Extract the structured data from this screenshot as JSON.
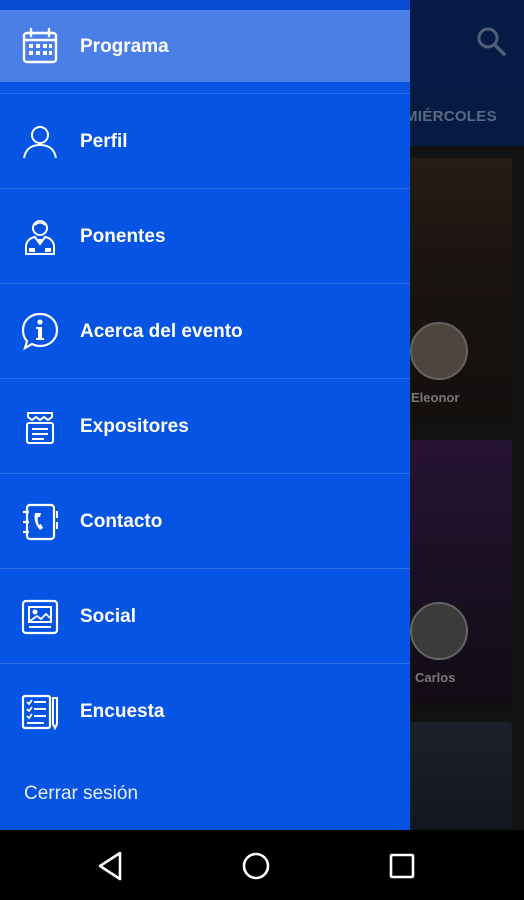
{
  "drawer": {
    "items": [
      {
        "label": "Programa",
        "icon": "calendar-icon"
      },
      {
        "label": "Perfil",
        "icon": "person-icon"
      },
      {
        "label": "Ponentes",
        "icon": "speaker-icon"
      },
      {
        "label": "Acerca del evento",
        "icon": "info-icon"
      },
      {
        "label": "Expositores",
        "icon": "exhibitor-icon"
      },
      {
        "label": "Contacto",
        "icon": "address-book-icon"
      },
      {
        "label": "Social",
        "icon": "social-icon"
      },
      {
        "label": "Encuesta",
        "icon": "survey-icon"
      }
    ],
    "logout_label": "Cerrar sesión",
    "selected_index": 0
  },
  "background": {
    "tab_label": "MIÉRCOLES",
    "cards": [
      {
        "speaker": "Eleonor"
      },
      {
        "speaker": "Carlos"
      }
    ]
  },
  "colors": {
    "drawer": "#0654e3",
    "selected_item": "#4a7fe8",
    "app_bar": "#0a2c6e"
  }
}
